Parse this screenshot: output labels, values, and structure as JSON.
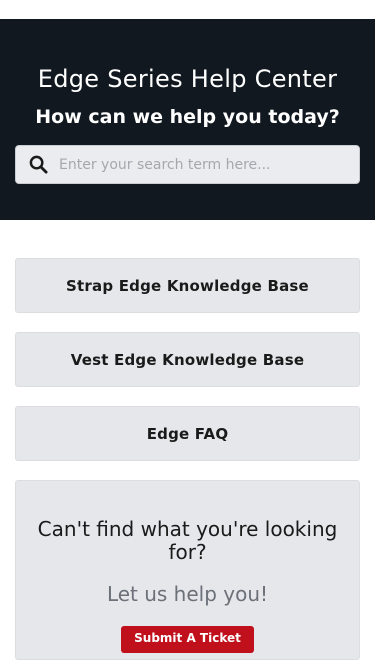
{
  "hero": {
    "title": "Edge Series Help Center",
    "subtitle": "How can we help you today?",
    "search_placeholder": "Enter your search term here...",
    "search_icon": "search-icon"
  },
  "knowledge_bases": [
    {
      "label": "Strap Edge Knowledge Base"
    },
    {
      "label": "Vest Edge Knowledge Base"
    },
    {
      "label": "Edge FAQ"
    }
  ],
  "help": {
    "title": "Can't find what you're looking for?",
    "subtitle": "Let us help you!",
    "button_label": "Submit A Ticket"
  },
  "colors": {
    "hero_bg": "#111820",
    "card_bg": "#e6e7ea",
    "button_bg": "#c0101c"
  }
}
